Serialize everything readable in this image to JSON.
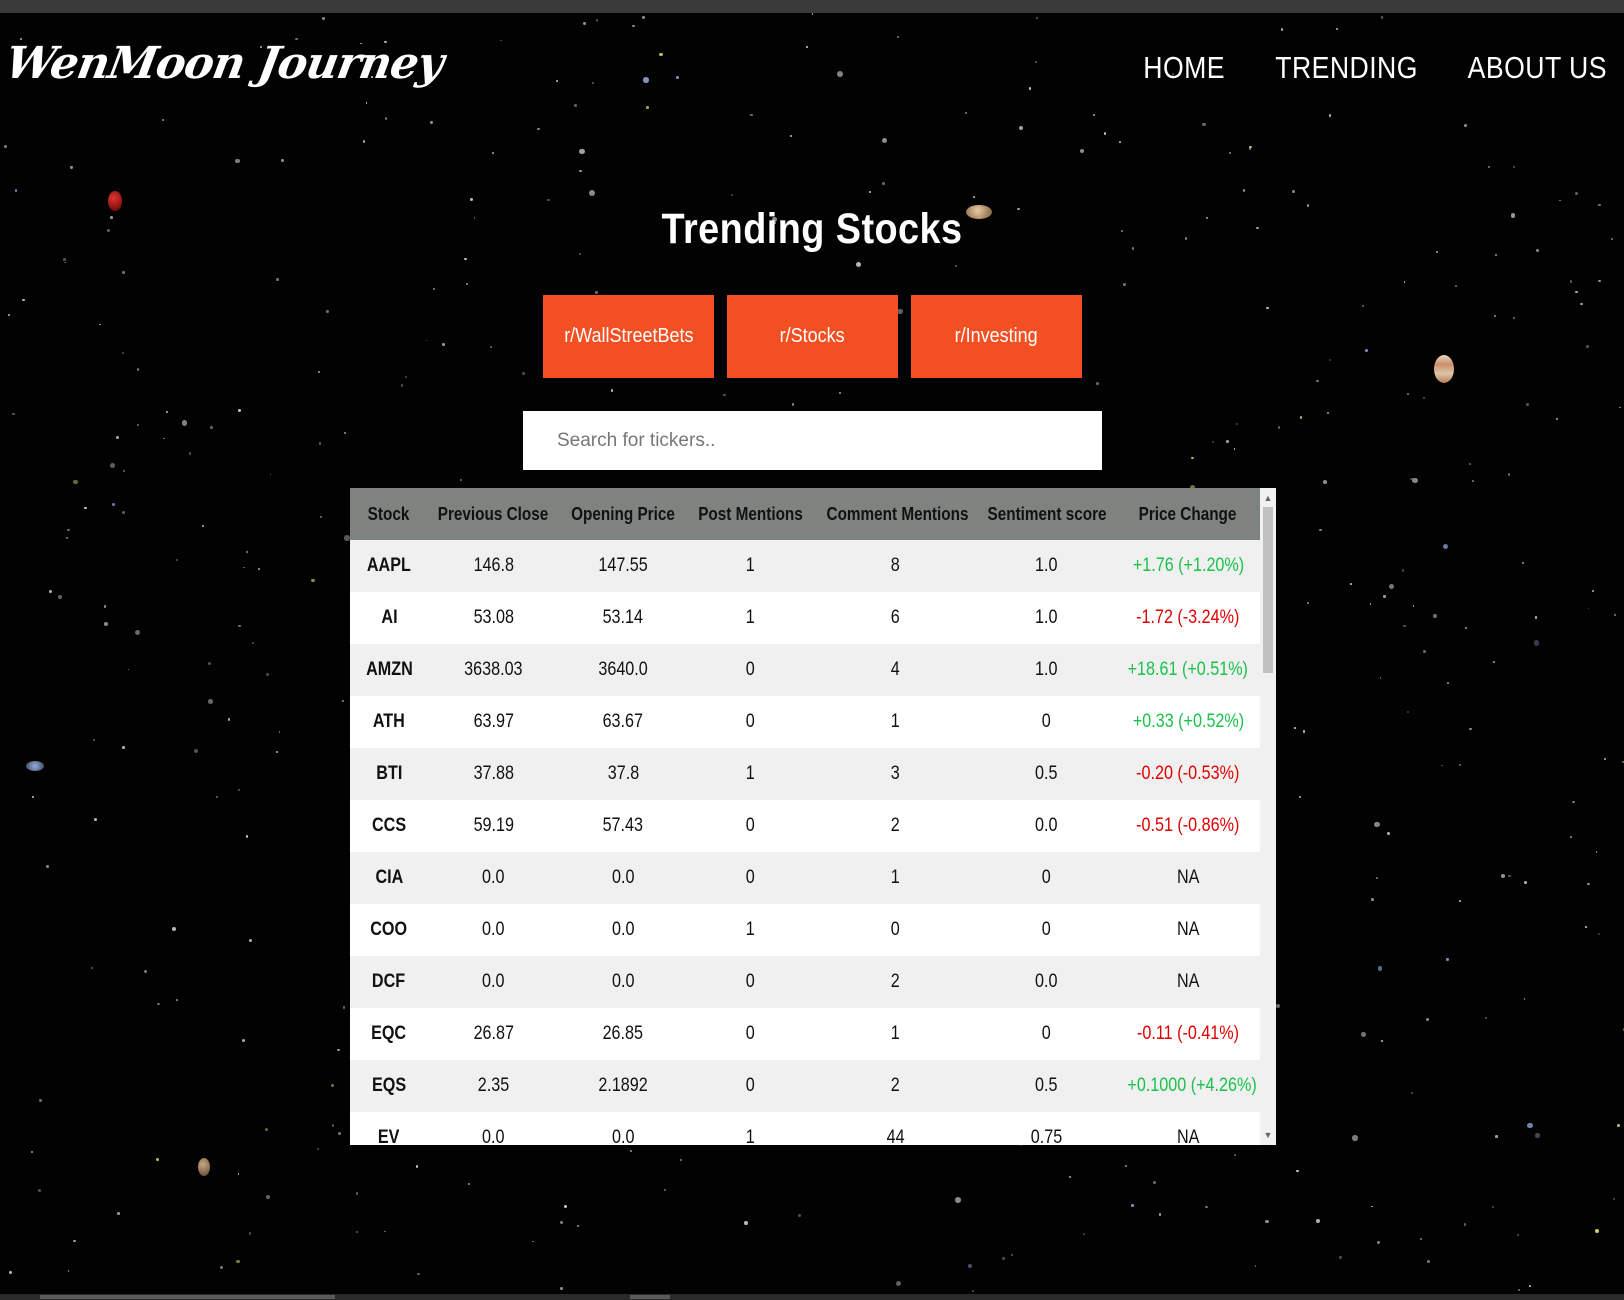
{
  "brand": "WenMoon Journey",
  "nav": [
    {
      "label": "HOME"
    },
    {
      "label": "TRENDING"
    },
    {
      "label": "ABOUT US"
    }
  ],
  "page_title": "Trending Stocks",
  "subreddits": [
    {
      "label": "r/WallStreetBets"
    },
    {
      "label": "r/Stocks"
    },
    {
      "label": "r/Investing"
    }
  ],
  "search": {
    "placeholder": "Search for tickers.."
  },
  "table": {
    "columns": [
      "Stock",
      "Previous Close",
      "Opening Price",
      "Post Mentions",
      "Comment Mentions",
      "Sentiment score",
      "Price Change"
    ],
    "rows": [
      {
        "stock": "AAPL",
        "previous_close": "146.8",
        "opening_price": "147.55",
        "post_mentions": "1",
        "comment_mentions": "8",
        "sentiment": "1.0",
        "price_change": "+1.76 (+1.20%)",
        "direction": "up"
      },
      {
        "stock": "AI",
        "previous_close": "53.08",
        "opening_price": "53.14",
        "post_mentions": "1",
        "comment_mentions": "6",
        "sentiment": "1.0",
        "price_change": "-1.72 (-3.24%)",
        "direction": "down"
      },
      {
        "stock": "AMZN",
        "previous_close": "3638.03",
        "opening_price": "3640.0",
        "post_mentions": "0",
        "comment_mentions": "4",
        "sentiment": "1.0",
        "price_change": "+18.61 (+0.51%)",
        "direction": "up"
      },
      {
        "stock": "ATH",
        "previous_close": "63.97",
        "opening_price": "63.67",
        "post_mentions": "0",
        "comment_mentions": "1",
        "sentiment": "0",
        "price_change": "+0.33 (+0.52%)",
        "direction": "up"
      },
      {
        "stock": "BTI",
        "previous_close": "37.88",
        "opening_price": "37.8",
        "post_mentions": "1",
        "comment_mentions": "3",
        "sentiment": "0.5",
        "price_change": "-0.20 (-0.53%)",
        "direction": "down"
      },
      {
        "stock": "CCS",
        "previous_close": "59.19",
        "opening_price": "57.43",
        "post_mentions": "0",
        "comment_mentions": "2",
        "sentiment": "0.0",
        "price_change": "-0.51 (-0.86%)",
        "direction": "down"
      },
      {
        "stock": "CIA",
        "previous_close": "0.0",
        "opening_price": "0.0",
        "post_mentions": "0",
        "comment_mentions": "1",
        "sentiment": "0",
        "price_change": "NA",
        "direction": "na"
      },
      {
        "stock": "COO",
        "previous_close": "0.0",
        "opening_price": "0.0",
        "post_mentions": "1",
        "comment_mentions": "0",
        "sentiment": "0",
        "price_change": "NA",
        "direction": "na"
      },
      {
        "stock": "DCF",
        "previous_close": "0.0",
        "opening_price": "0.0",
        "post_mentions": "0",
        "comment_mentions": "2",
        "sentiment": "0.0",
        "price_change": "NA",
        "direction": "na"
      },
      {
        "stock": "EQC",
        "previous_close": "26.87",
        "opening_price": "26.85",
        "post_mentions": "0",
        "comment_mentions": "1",
        "sentiment": "0",
        "price_change": "-0.11 (-0.41%)",
        "direction": "down"
      },
      {
        "stock": "EQS",
        "previous_close": "2.35",
        "opening_price": "2.1892",
        "post_mentions": "0",
        "comment_mentions": "2",
        "sentiment": "0.5",
        "price_change": "+0.1000 (+4.26%)",
        "direction": "up"
      },
      {
        "stock": "EV",
        "previous_close": "0.0",
        "opening_price": "0.0",
        "post_mentions": "1",
        "comment_mentions": "44",
        "sentiment": "0.75",
        "price_change": "NA",
        "direction": "na"
      }
    ]
  },
  "colors": {
    "accent": "#f25022",
    "positive": "#19c24a",
    "negative": "#e00000",
    "header": "#7e8380",
    "background": "#020202"
  },
  "icons": {
    "scroll_up": "scroll-up-arrow-icon",
    "scroll_down": "scroll-down-arrow-icon"
  }
}
